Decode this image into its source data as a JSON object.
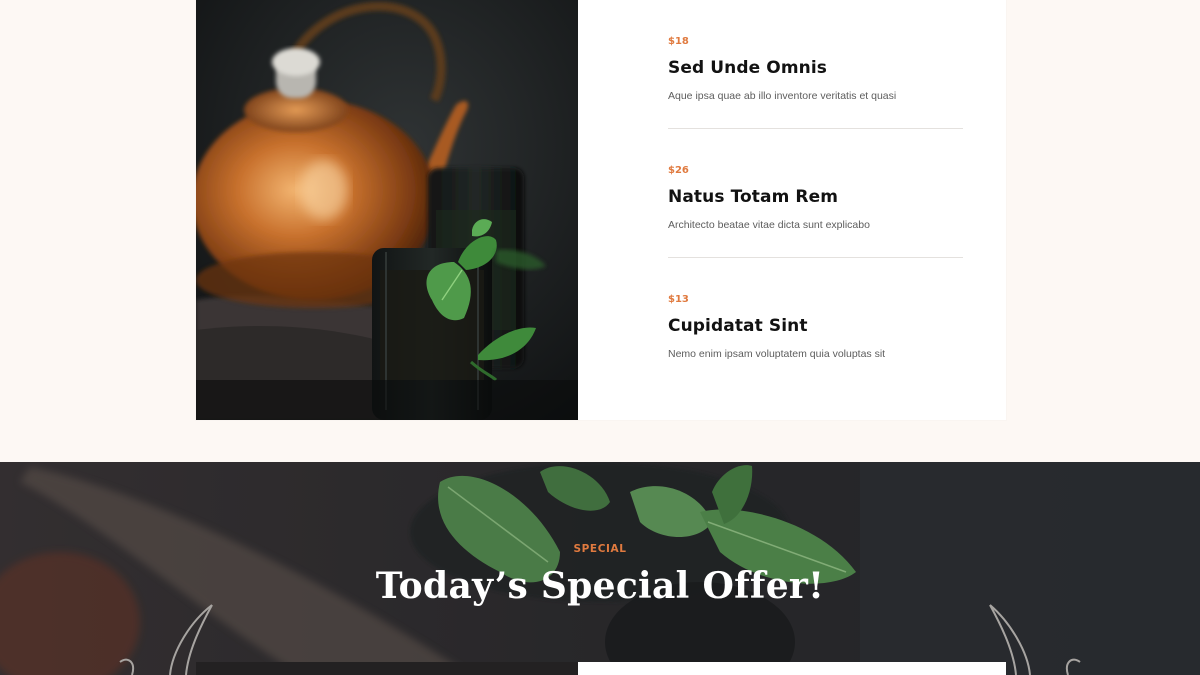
{
  "menu": {
    "items": [
      {
        "price": "$18",
        "name": "Sed Unde Omnis",
        "description": "Aque ipsa quae ab illo inventore veritatis et quasi"
      },
      {
        "price": "$26",
        "name": "Natus Totam Rem",
        "description": "Architecto beatae vitae dicta sunt explicabo"
      },
      {
        "price": "$13",
        "name": "Cupidatat Sint",
        "description": "Nemo enim ipsam voluptatem quia voluptas sit"
      }
    ]
  },
  "special": {
    "eyebrow": "SPECIAL",
    "title": "Today’s Special Offer!"
  },
  "colors": {
    "accent": "#e07a3f",
    "page_background": "#fdf8f4",
    "card_background": "#ffffff",
    "dark_section": "#2a2a2c"
  },
  "icons": {
    "left_ornament": "horn-ornament-icon",
    "right_ornament": "horn-ornament-icon"
  }
}
